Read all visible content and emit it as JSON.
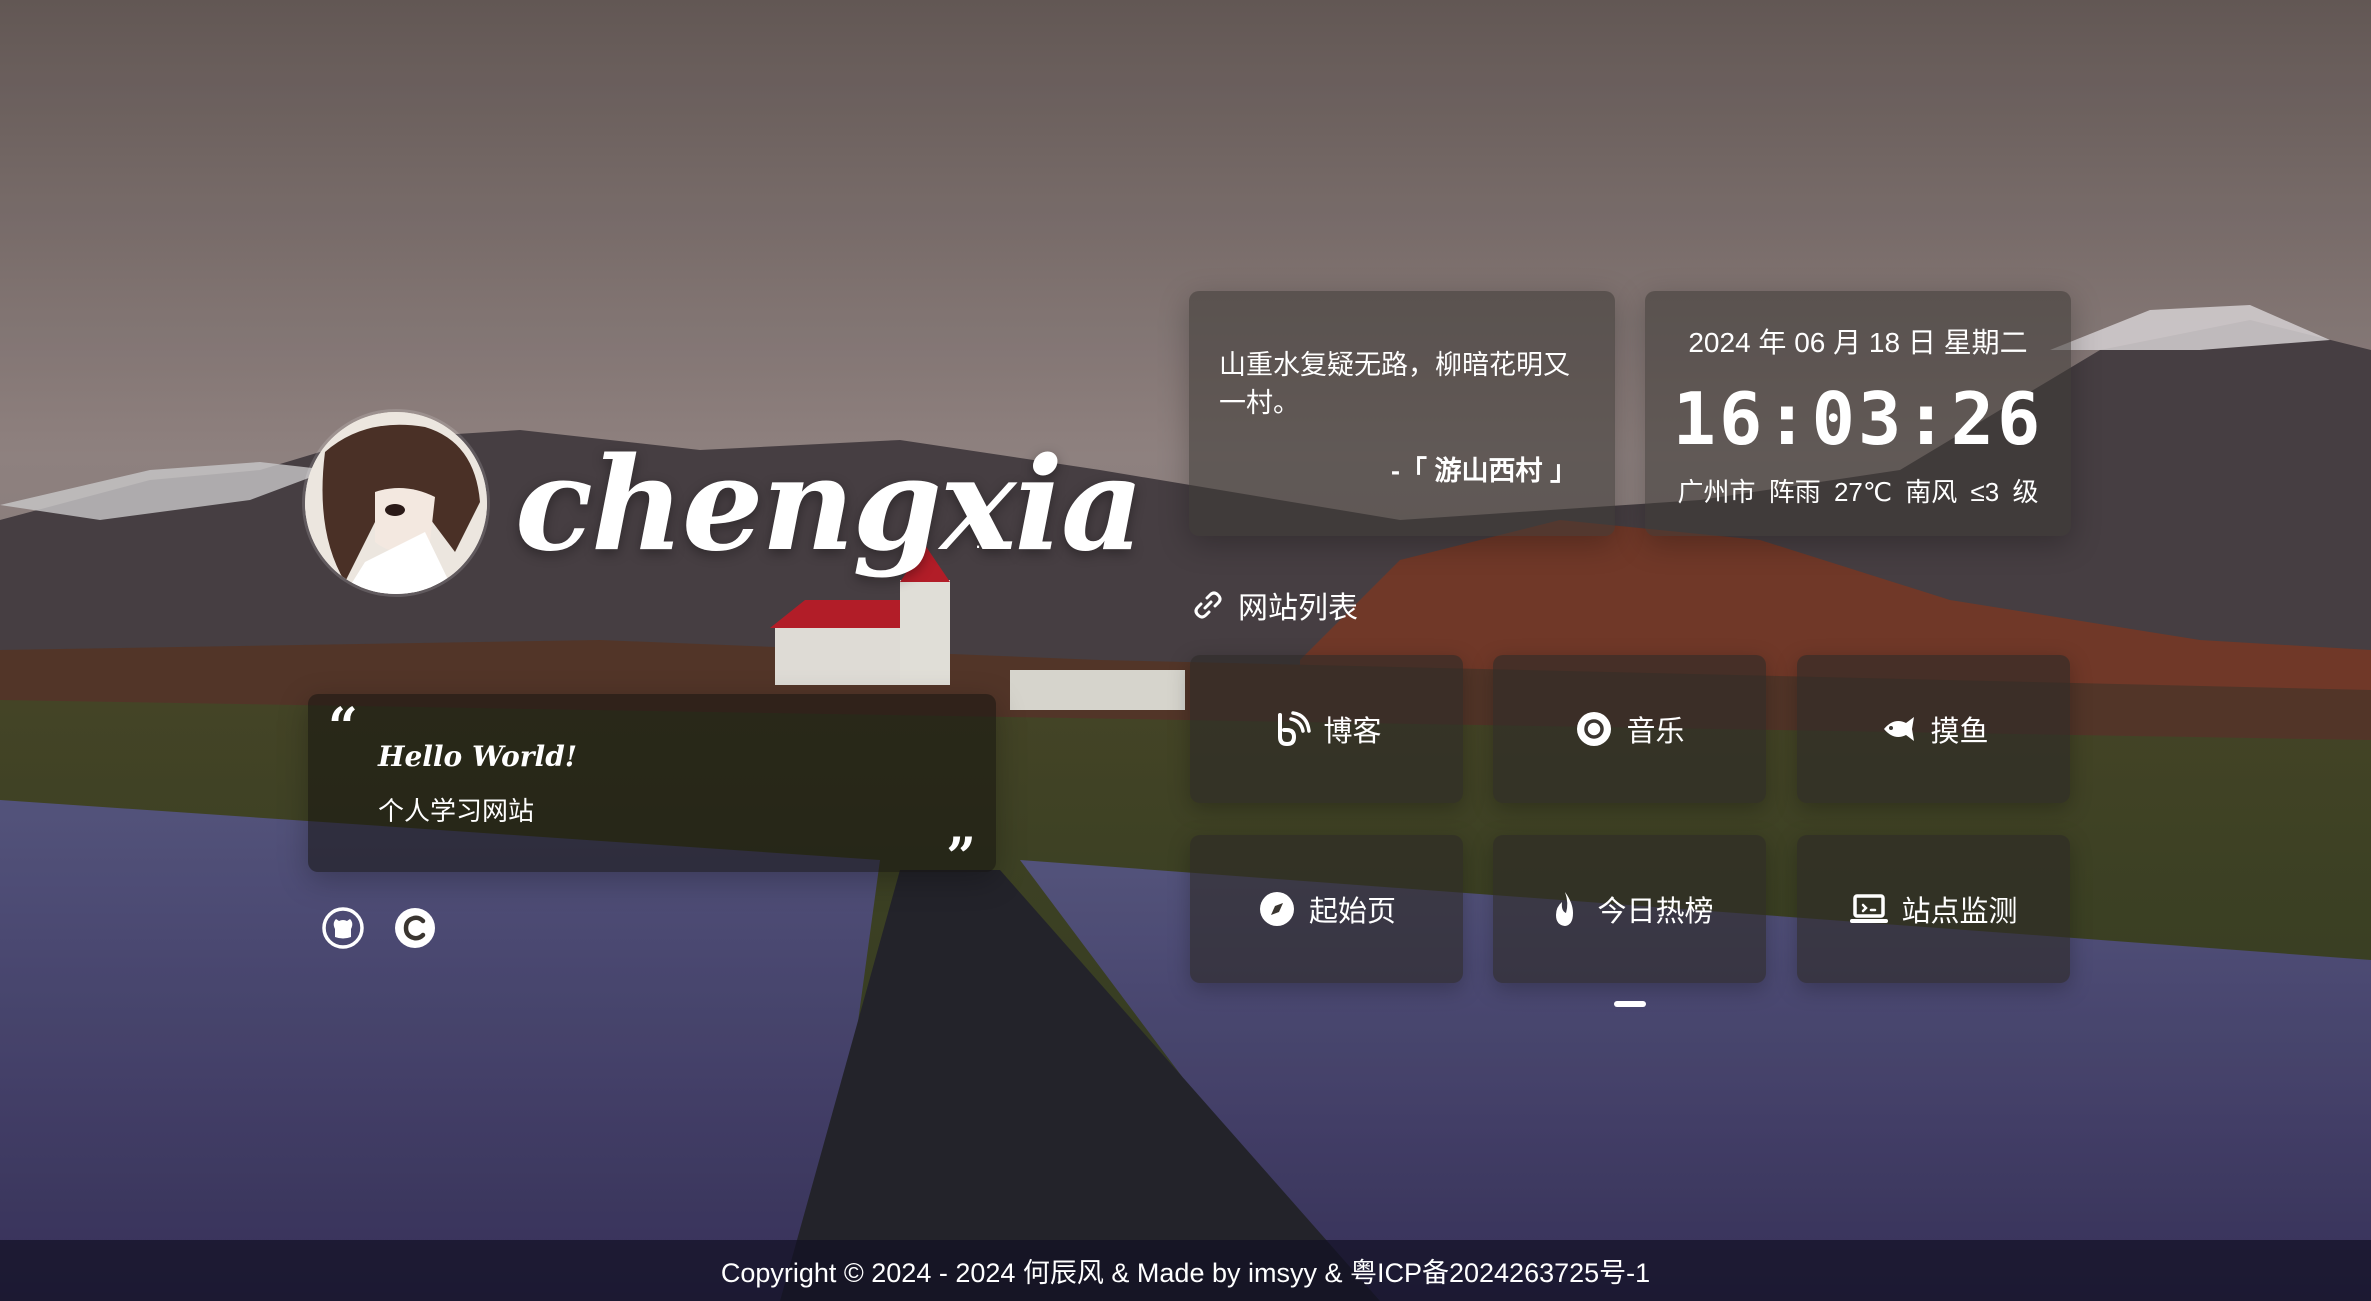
{
  "brand": {
    "name": "chengxia",
    "dots": "..."
  },
  "intro": {
    "hello": "Hello World!",
    "subtitle": "个人学习网站"
  },
  "social": [
    {
      "name": "github",
      "icon": "github-icon"
    },
    {
      "name": "csdn",
      "icon": "csdn-icon"
    }
  ],
  "poem": {
    "text": "山重水复疑无路，柳暗花明又一村。",
    "source": "-「 游山西村 」"
  },
  "clock": {
    "date": "2024 年 06 月 18 日 星期二",
    "time": "16:03:26",
    "weather": "广州市 阵雨 27℃ 南风 ≤3 级"
  },
  "links": {
    "title": "网站列表",
    "title_icon": "link-icon",
    "items": [
      {
        "label": "博客",
        "icon": "blog-icon"
      },
      {
        "label": "音乐",
        "icon": "music-icon"
      },
      {
        "label": "摸鱼",
        "icon": "fish-icon"
      },
      {
        "label": "起始页",
        "icon": "compass-icon"
      },
      {
        "label": "今日热榜",
        "icon": "fire-icon"
      },
      {
        "label": "站点监测",
        "icon": "monitor-icon"
      }
    ],
    "active_page": 1,
    "page_count": 1
  },
  "footer": {
    "text": "Copyright © 2024 - 2024 何辰风 & Made by imsyy & 粤ICP备2024263725号-1"
  }
}
